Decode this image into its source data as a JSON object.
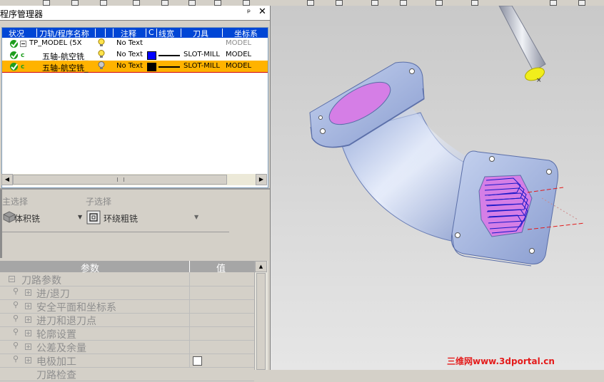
{
  "panel": {
    "title": "程序管理器",
    "pin_glyph": "ᵖ",
    "close_glyph": "✕"
  },
  "tree": {
    "columns": [
      "状况",
      "刀轨/程序名称",
      "注释",
      "C",
      "线宽",
      "刀具",
      "坐标系"
    ],
    "rows": [
      {
        "name": "TP_MODEL (5X",
        "note": "No Text",
        "tool": "",
        "coord": "MODEL",
        "coord_color": "#8a8a8a",
        "highlight": false,
        "swatch": ""
      },
      {
        "name": "五轴-航空铣_",
        "note": "No Text",
        "tool": "SLOT-MILL",
        "coord": "MODEL",
        "coord_color": "#000000",
        "highlight": false,
        "swatch": "#0000ff"
      },
      {
        "name": "五轴-航空铣_",
        "note": "No Text",
        "tool": "SLOT-MILL",
        "coord": "MODEL",
        "coord_color": "#000000",
        "highlight": true,
        "swatch": "#000000"
      }
    ],
    "c_marker": "c"
  },
  "selection": {
    "main_label": "主选择",
    "main_value": "体积铣",
    "sub_label": "子选择",
    "sub_value": "环绕粗铣"
  },
  "params": {
    "col_param": "参数",
    "col_value": "值",
    "group": "刀路参数",
    "items": [
      "进/退刀",
      "安全平面和坐标系",
      "进刀和退刀点",
      "轮廓设置",
      "公差及余量",
      "电极加工",
      "刀路检查"
    ]
  },
  "watermark": "三维网www.3dportal.cn",
  "colors": {
    "header_blue": "#0046d5",
    "highlight": "#ffb300",
    "part_body": "#a9bde6",
    "pocket": "#d88be3"
  }
}
